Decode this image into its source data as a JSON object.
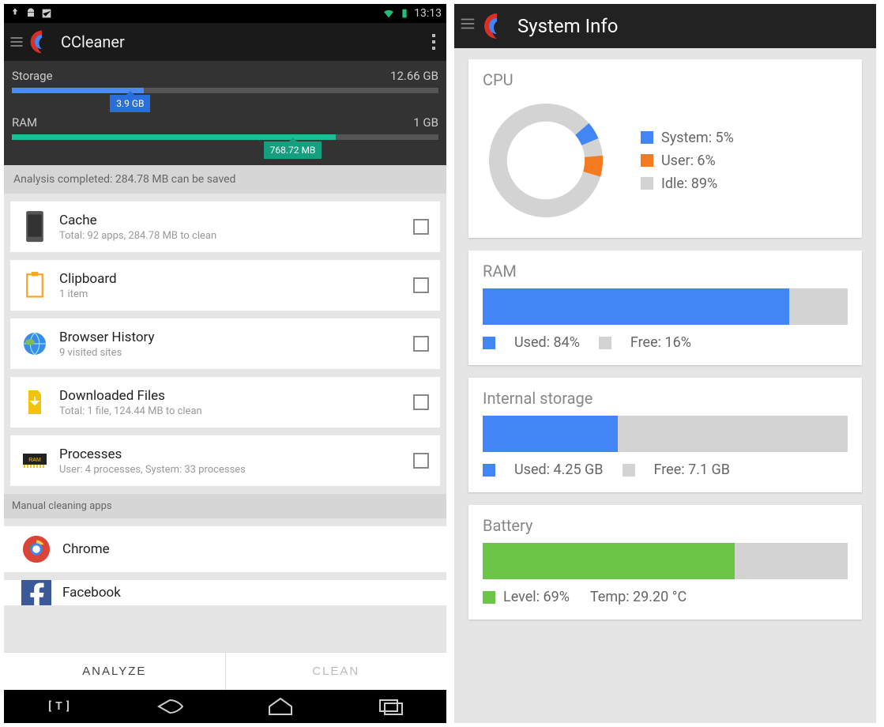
{
  "left": {
    "status": {
      "time": "13:13"
    },
    "appbar": {
      "title": "CCleaner"
    },
    "usage": {
      "storage_label": "Storage",
      "storage_total": "12.66 GB",
      "storage_used_tag": "3.9 GB",
      "storage_pct": 31,
      "ram_label": "RAM",
      "ram_total": "1 GB",
      "ram_used_tag": "768.72 MB",
      "ram_pct": 76
    },
    "analysis_banner": "Analysis completed: 284.78 MB can be saved",
    "items": [
      {
        "title": "Cache",
        "sub": "Total: 92 apps, 284.78 MB to clean"
      },
      {
        "title": "Clipboard",
        "sub": "1 item"
      },
      {
        "title": "Browser History",
        "sub": "9 visited sites"
      },
      {
        "title": "Downloaded Files",
        "sub": "Total: 1 file, 124.44 MB to clean"
      },
      {
        "title": "Processes",
        "sub": "User: 4 processes, System: 33 processes"
      }
    ],
    "manual_section": "Manual cleaning apps",
    "manual_apps": [
      {
        "title": "Chrome"
      },
      {
        "title": "Facebook"
      }
    ],
    "actions": {
      "analyze": "ANALYZE",
      "clean": "CLEAN"
    }
  },
  "right": {
    "title": "System Info",
    "cpu": {
      "heading": "CPU",
      "legend": [
        {
          "label": "System: 5%",
          "color": "#4285f4"
        },
        {
          "label": "User: 6%",
          "color": "#f47b1f"
        },
        {
          "label": "Idle: 89%",
          "color": "#d3d3d3"
        }
      ]
    },
    "ram": {
      "heading": "RAM",
      "used_pct": 84,
      "used_label": "Used: 84%",
      "free_label": "Free: 16%"
    },
    "storage": {
      "heading": "Internal storage",
      "used_pct": 37,
      "used_label": "Used: 4.25 GB",
      "free_label": "Free: 7.1 GB"
    },
    "battery": {
      "heading": "Battery",
      "level_pct": 69,
      "level_label": "Level: 69%",
      "temp_label": "Temp: 29.20 °C"
    }
  },
  "chart_data": [
    {
      "type": "bar",
      "title": "Storage usage",
      "categories": [
        "Storage"
      ],
      "values": [
        3.9
      ],
      "ylim": [
        0,
        12.66
      ],
      "ylabel": "GB"
    },
    {
      "type": "bar",
      "title": "RAM usage",
      "categories": [
        "RAM"
      ],
      "values": [
        768.72
      ],
      "ylim": [
        0,
        1024
      ],
      "ylabel": "MB"
    },
    {
      "type": "pie",
      "title": "CPU",
      "categories": [
        "System",
        "User",
        "Idle"
      ],
      "values": [
        5,
        6,
        89
      ]
    },
    {
      "type": "bar",
      "title": "RAM",
      "categories": [
        "Used",
        "Free"
      ],
      "values": [
        84,
        16
      ],
      "ylabel": "%"
    },
    {
      "type": "bar",
      "title": "Internal storage",
      "categories": [
        "Used",
        "Free"
      ],
      "values": [
        4.25,
        7.1
      ],
      "ylabel": "GB"
    },
    {
      "type": "bar",
      "title": "Battery",
      "categories": [
        "Level"
      ],
      "values": [
        69
      ],
      "ylim": [
        0,
        100
      ],
      "ylabel": "%"
    }
  ]
}
